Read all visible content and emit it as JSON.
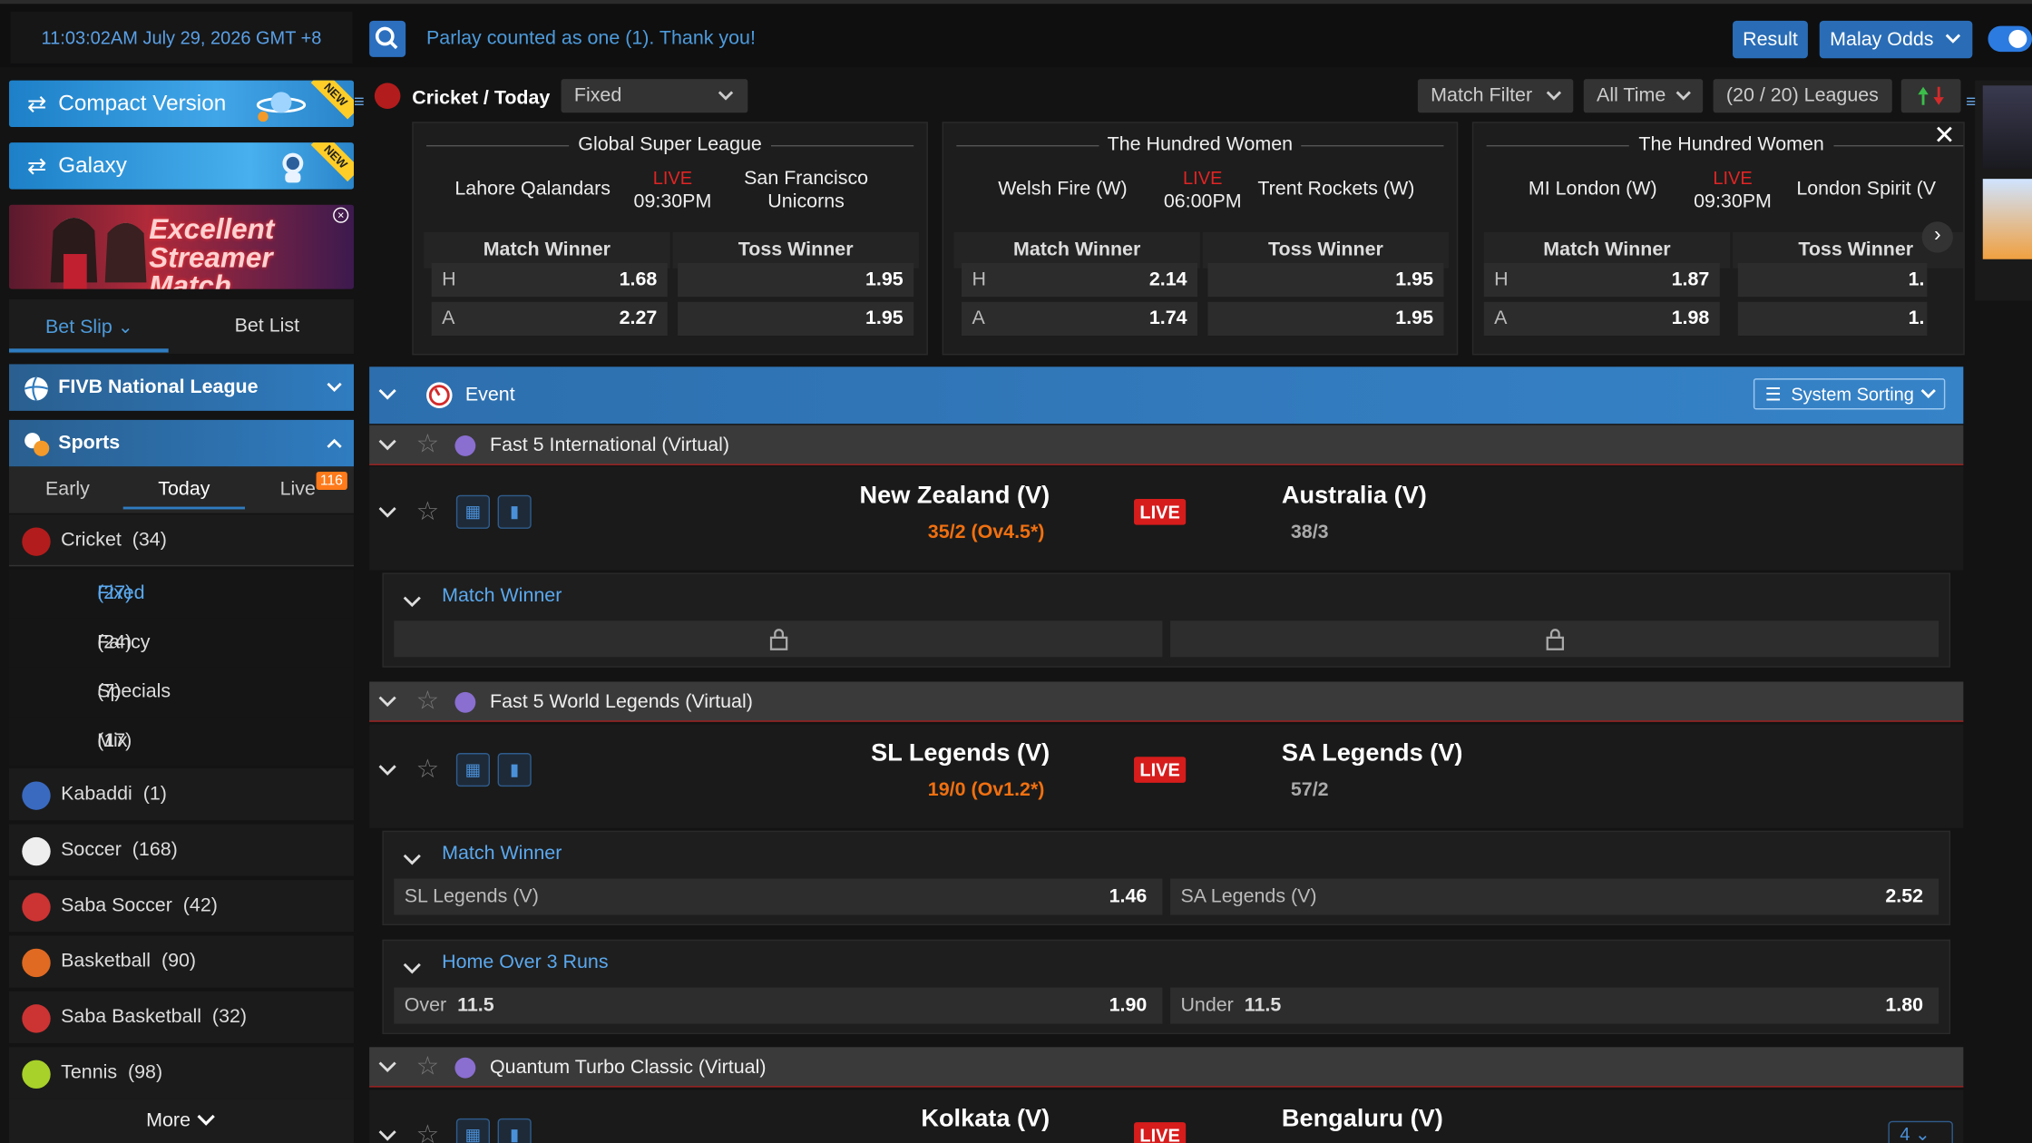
{
  "topbar": {
    "clock": "11:03:02AM July 29, 2026 GMT +8",
    "ticker": "Parlay counted as one (1). Thank you!",
    "result": "Result",
    "odds_type": "Malay Odds"
  },
  "banners": {
    "compact": "Compact Version",
    "galaxy": "Galaxy",
    "new": "NEW",
    "promo": "Excellent Streamer Match"
  },
  "slip": {
    "bet_slip": "Bet Slip",
    "bet_list": "Bet List"
  },
  "fivb": "FIVB National League",
  "sports_header": "Sports",
  "subtabs": {
    "early": "Early",
    "today": "Today",
    "live": "Live",
    "live_count": "116"
  },
  "sports": [
    {
      "name": "Cricket",
      "count": "(34)"
    },
    {
      "name": "Kabaddi",
      "count": "(1)"
    },
    {
      "name": "Soccer",
      "count": "(168)"
    },
    {
      "name": "Saba Soccer",
      "count": "(42)"
    },
    {
      "name": "Basketball",
      "count": "(90)"
    },
    {
      "name": "Saba Basketball",
      "count": "(32)"
    },
    {
      "name": "Tennis",
      "count": "(98)"
    }
  ],
  "cricket_sub": [
    {
      "name": "Fixed",
      "count": "(27)"
    },
    {
      "name": "Fancy",
      "count": "(24)"
    },
    {
      "name": "Specials",
      "count": "(7)"
    },
    {
      "name": "Mix Parlay",
      "count": "(17)"
    }
  ],
  "more": "More",
  "header": {
    "crumb": "Cricket / Today",
    "market_select": "Fixed",
    "match_filter": "Match Filter",
    "time_filter": "All Time",
    "leagues": "(20 / 20) Leagues"
  },
  "cards": [
    {
      "league": "Global Super League",
      "home": "Lahore Qalandars",
      "away_l1": "San Francisco",
      "away_l2": "Unicorns",
      "live": "LIVE",
      "time": "09:30PM",
      "m1": "Match Winner",
      "m2": "Toss Winner",
      "h": "H",
      "a": "A",
      "mw_h": "1.68",
      "mw_a": "2.27",
      "tw_h": "1.95",
      "tw_a": "1.95"
    },
    {
      "league": "The Hundred Women",
      "home": "Welsh Fire (W)",
      "away_l1": "Trent Rockets (W)",
      "away_l2": "",
      "live": "LIVE",
      "time": "06:00PM",
      "m1": "Match Winner",
      "m2": "Toss Winner",
      "h": "H",
      "a": "A",
      "mw_h": "2.14",
      "mw_a": "1.74",
      "tw_h": "1.95",
      "tw_a": "1.95"
    },
    {
      "league": "The Hundred Women",
      "home": "MI London (W)",
      "away_l1": "London Spirit (V",
      "away_l2": "",
      "live": "LIVE",
      "time": "09:30PM",
      "m1": "Match Winner",
      "m2": "Toss Winner",
      "h": "H",
      "a": "A",
      "mw_h": "1.87",
      "mw_a": "1.98",
      "tw_h": "1.",
      "tw_a": "1."
    }
  ],
  "event": {
    "label": "Event",
    "sorting": "System Sorting"
  },
  "leagues": [
    {
      "name": "Fast 5 International (Virtual)"
    },
    {
      "name": "Fast 5 World Legends (Virtual)"
    },
    {
      "name": "Quantum Turbo Classic (Virtual)"
    }
  ],
  "matches": [
    {
      "home": "New Zealand (V)",
      "home_score": "35/2 (Ov4.5*)",
      "live": "LIVE",
      "away": "Australia (V)",
      "away_score": "38/3"
    },
    {
      "home": "SL Legends (V)",
      "home_score": "19/0 (Ov1.2*)",
      "live": "LIVE",
      "away": "SA Legends (V)",
      "away_score": "57/2"
    },
    {
      "home": "Kolkata (V)",
      "live": "LIVE",
      "away": "Bengaluru (V)",
      "count": "4"
    }
  ],
  "markets": {
    "m1": {
      "title": "Match Winner"
    },
    "m2": {
      "title": "Match Winner",
      "home": "SL Legends (V)",
      "home_odds": "1.46",
      "away": "SA Legends (V)",
      "away_odds": "2.52"
    },
    "m3": {
      "title": "Home Over 3 Runs",
      "over": "Over",
      "over_line": "11.5",
      "over_odds": "1.90",
      "under": "Under",
      "under_line": "11.5",
      "under_odds": "1.80"
    }
  },
  "colors": {
    "accent": "#2a6db6",
    "live": "#d71c1c",
    "score": "#f07010"
  }
}
